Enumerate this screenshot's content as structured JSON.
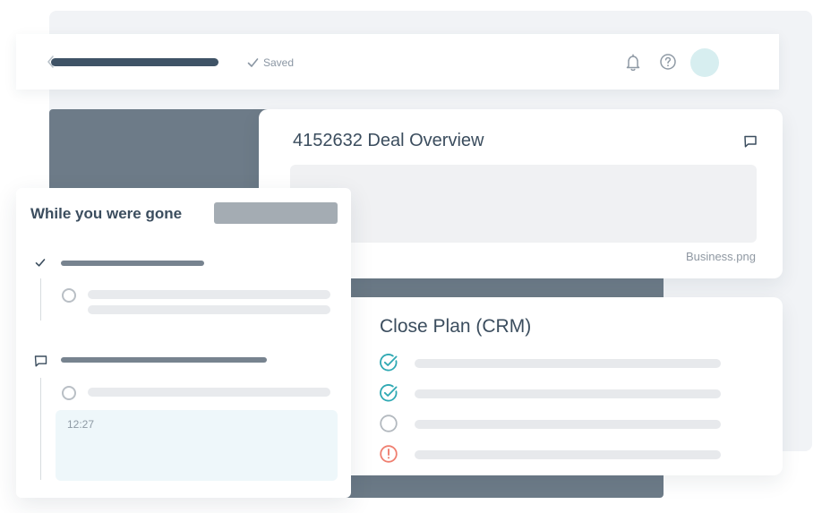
{
  "topbar": {
    "saved_label": "Saved",
    "icons": [
      "back-chevron-icon",
      "checkmark-icon",
      "bell-icon",
      "help-icon"
    ]
  },
  "deal_card": {
    "title": "4152632 Deal Overview",
    "attachment_name": "Business.png",
    "icon": "comment-icon"
  },
  "close_plan": {
    "title": "Close Plan (CRM)",
    "tasks": [
      {
        "status": "complete"
      },
      {
        "status": "complete"
      },
      {
        "status": "pending"
      },
      {
        "status": "alert"
      }
    ]
  },
  "activity": {
    "title": "While you were gone",
    "note_time": "12:27"
  },
  "colors": {
    "accent_teal": "#2fa9b3",
    "alert_red": "#ef7f70",
    "heading": "#3b4d5e",
    "slate": "#6d7b88"
  }
}
